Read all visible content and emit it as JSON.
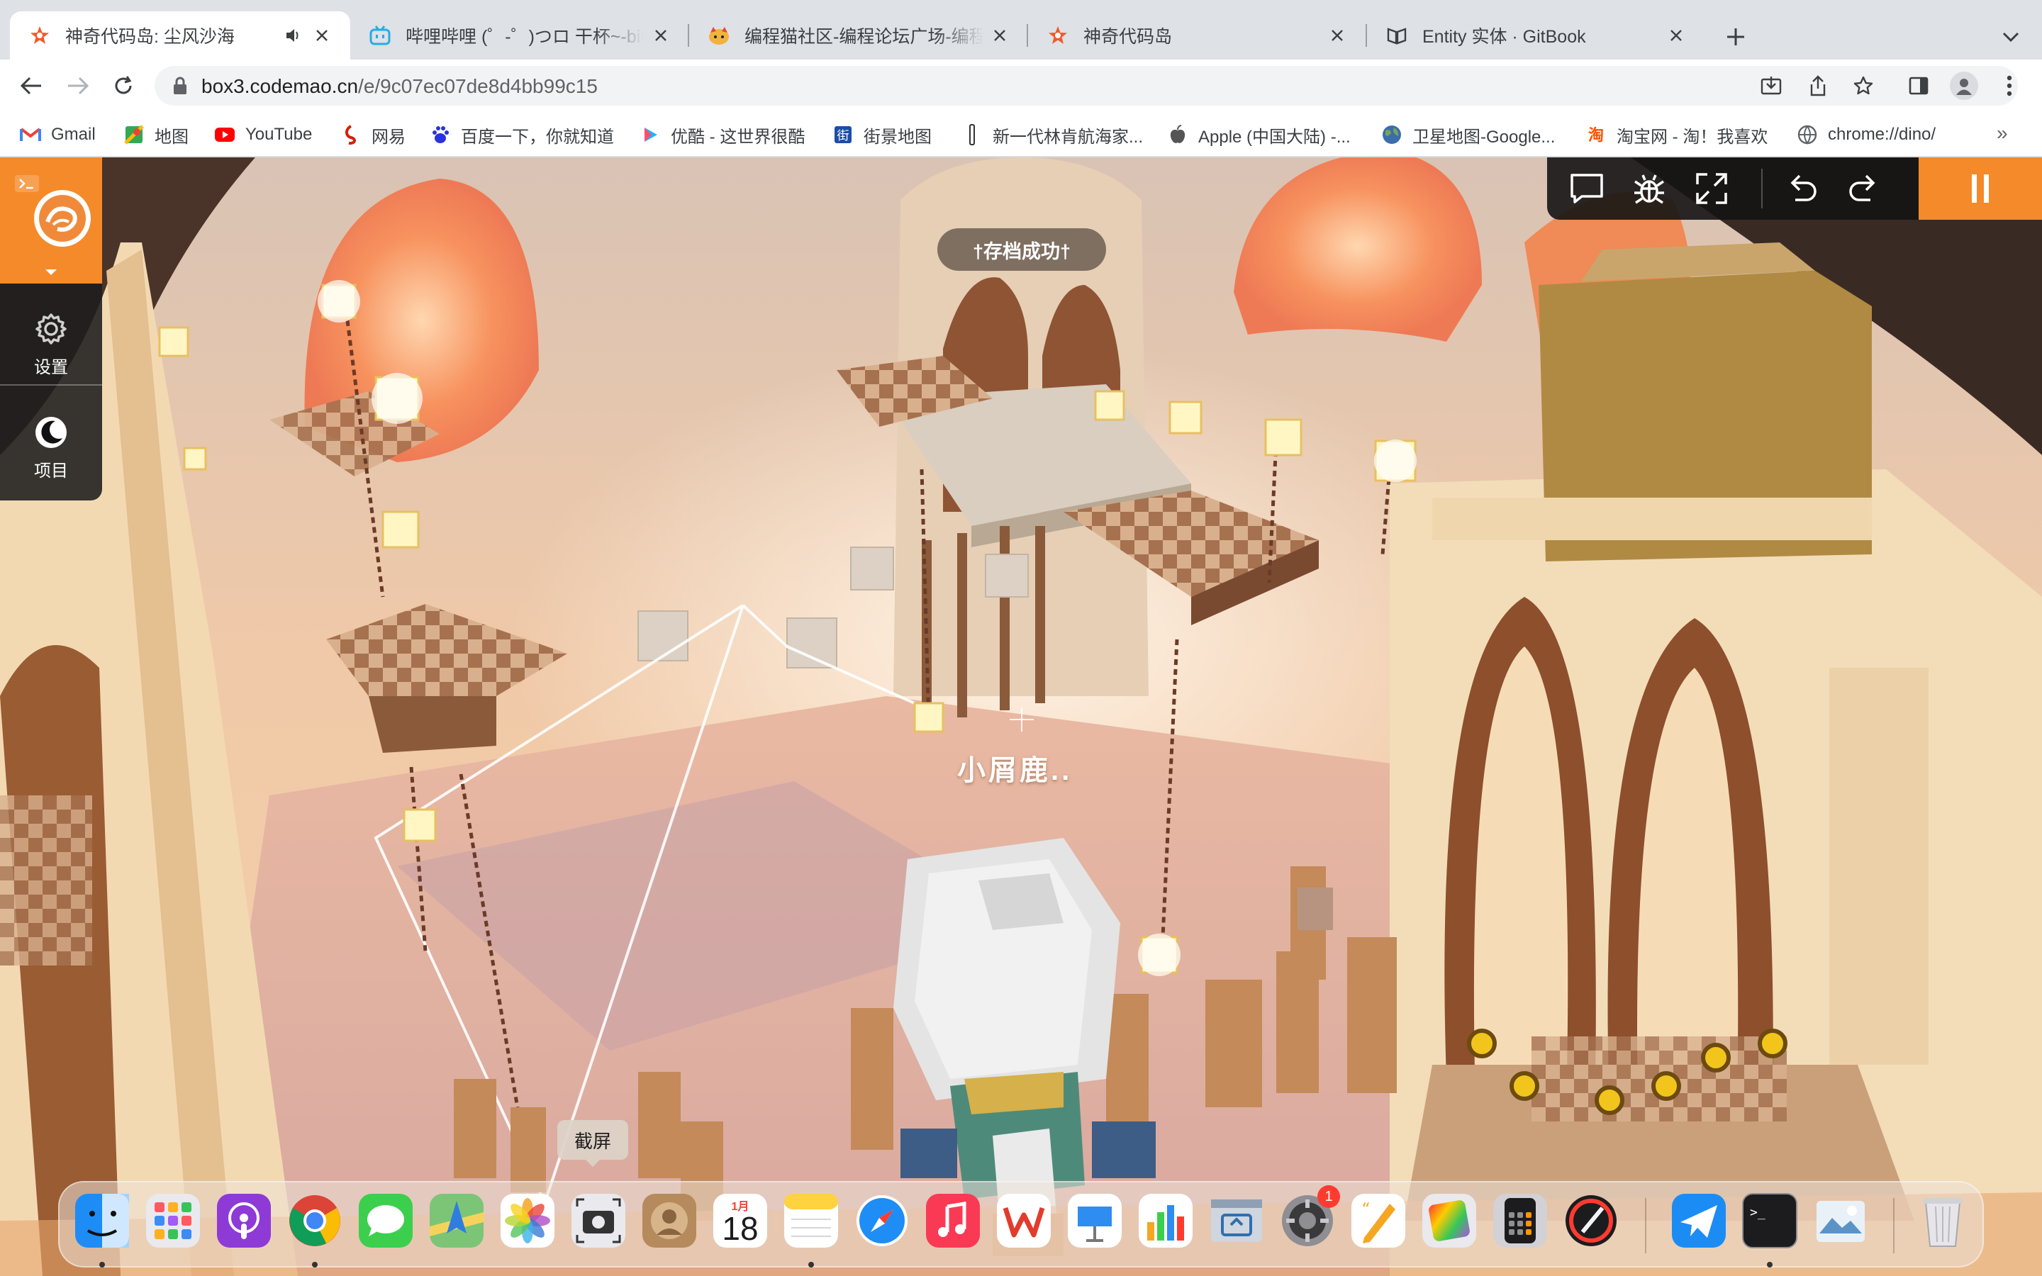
{
  "browser": {
    "tabs": [
      {
        "title": "神奇代码岛: 尘风沙海",
        "favicon": "codemao-star-icon",
        "active": true,
        "audio": true
      },
      {
        "title": "哔哩哔哩 (゜-゜)つロ 干杯~-bilibili",
        "favicon": "bilibili-tv-icon"
      },
      {
        "title": "编程猫社区-编程论坛广场-编程学习",
        "favicon": "codemao-cat-icon"
      },
      {
        "title": "神奇代码岛",
        "favicon": "codemao-star-icon"
      },
      {
        "title": "Entity 实体 · GitBook",
        "favicon": "gitbook-icon"
      }
    ],
    "url_host": "box3.codemao.cn",
    "url_path": "/e/9c07ec07de8d4bb99c15",
    "bookmarks": [
      {
        "label": "Gmail",
        "icon": "gmail-icon"
      },
      {
        "label": "地图",
        "icon": "maps-icon"
      },
      {
        "label": "YouTube",
        "icon": "youtube-icon"
      },
      {
        "label": "网易",
        "icon": "netease-icon"
      },
      {
        "label": "百度一下，你就知道",
        "icon": "baidu-icon"
      },
      {
        "label": "优酷 - 这世界很酷",
        "icon": "youku-icon"
      },
      {
        "label": "街景地图",
        "icon": "street-view-icon"
      },
      {
        "label": "新一代林肯航海家...",
        "icon": "lincoln-icon"
      },
      {
        "label": "Apple (中国大陆) -...",
        "icon": "apple-icon"
      },
      {
        "label": "卫星地图-Google...",
        "icon": "globe-icon"
      },
      {
        "label": "淘宝网 - 淘！我喜欢",
        "icon": "taobao-icon"
      },
      {
        "label": "chrome://dino/",
        "icon": "chrome-globe-icon"
      }
    ],
    "bookmarks_more": "»"
  },
  "game": {
    "sidebar": {
      "settings_label": "设置",
      "project_label": "项目"
    },
    "toast": "†存档成功†",
    "player_name": "小屑鹿..",
    "tooltip": "截屏"
  },
  "dock": {
    "calendar_month": "1月",
    "calendar_day": "18",
    "settings_badge": "1",
    "apps": [
      "finder-icon",
      "launchpad-icon",
      "podcasts-icon",
      "chrome-icon",
      "messages-icon",
      "maps-icon",
      "photos-icon",
      "screenshot-icon",
      "contacts-icon",
      "calendar-icon",
      "notes-icon",
      "safari-icon",
      "music-icon",
      "wps-icon",
      "keynote-icon",
      "numbers-icon",
      "screen-sharing-icon",
      "system-preferences-icon",
      "pages-icon",
      "color-picker-icon",
      "calculator-icon",
      "instruments-icon",
      "mail-plane-icon",
      "terminal-icon",
      "preview-icon",
      "trash-icon"
    ]
  },
  "colors": {
    "accent": "#f58a2a",
    "tab_bg": "#dee1e6"
  }
}
